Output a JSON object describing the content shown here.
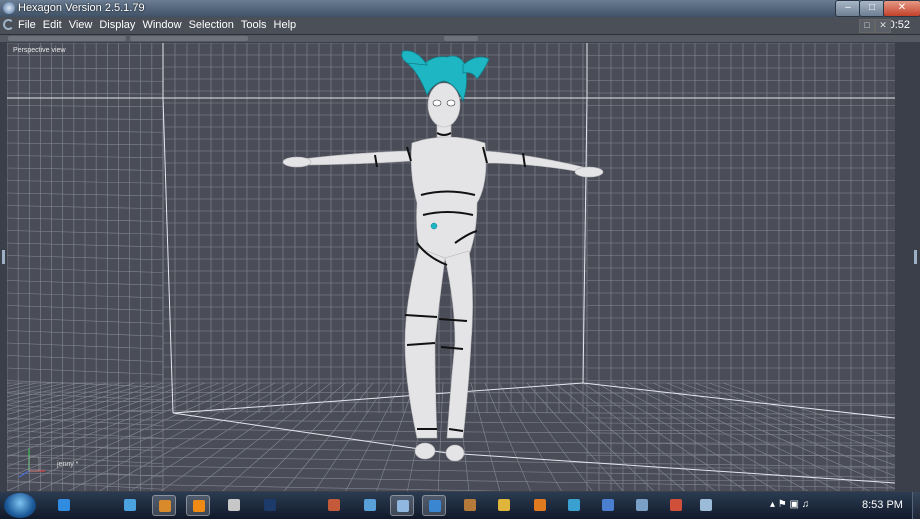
{
  "window": {
    "title": "Hexagon Version 2.5.1.79"
  },
  "menu": {
    "items": [
      "File",
      "Edit",
      "View",
      "Display",
      "Window",
      "Selection",
      "Tools",
      "Help"
    ],
    "clock": "20:52"
  },
  "viewport": {
    "label": "Perspective view",
    "object_name": "jenny *"
  },
  "taskbar": {
    "time": "8:53 PM",
    "icons": [
      {
        "name": "ie-icon",
        "color": "#2f8ce0"
      },
      {
        "name": "media-center-icon",
        "color": "#4aa3df"
      },
      {
        "name": "media-player-icon",
        "color": "#d98b2c"
      },
      {
        "name": "vlc-icon",
        "color": "#f08a14"
      },
      {
        "name": "dvd-icon",
        "color": "#c7c7c7"
      },
      {
        "name": "photoshop-icon",
        "color": "#1c3b6b"
      },
      {
        "name": "avatar-app-icon",
        "color": "#c45a3a"
      },
      {
        "name": "app-icon",
        "color": "#5aa0d8"
      },
      {
        "name": "document-icon",
        "color": "#8fb7e0"
      },
      {
        "name": "hexagon-icon",
        "color": "#3a86d1"
      },
      {
        "name": "gimp-icon",
        "color": "#b57a3a"
      },
      {
        "name": "chrome-icon",
        "color": "#e0b63a"
      },
      {
        "name": "blender-icon",
        "color": "#e07a1e"
      },
      {
        "name": "refresh-app-icon",
        "color": "#3aa0d0"
      },
      {
        "name": "play-app-icon",
        "color": "#4a7fd0"
      },
      {
        "name": "settings-app-icon",
        "color": "#7aa0c8"
      },
      {
        "name": "paint-app-icon",
        "color": "#d0503a"
      },
      {
        "name": "window-app-icon",
        "color": "#9bbbd8"
      }
    ]
  },
  "colors": {
    "grid_bg": "#4a4d57",
    "grid_line": "#8a8d99",
    "model": "#e6e6e6",
    "hair": "#20b8c4"
  }
}
